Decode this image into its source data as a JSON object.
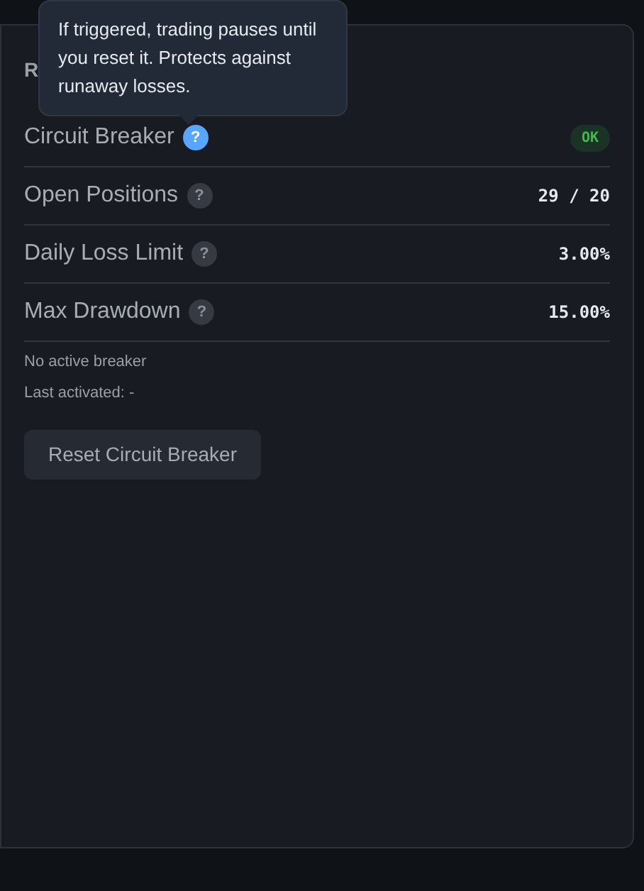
{
  "panel": {
    "title": "R"
  },
  "tooltip": {
    "text": "If triggered, trading pauses until you reset it. Protects against runaway losses."
  },
  "rows": [
    {
      "label": "Circuit Breaker",
      "help": "?",
      "help_active": true,
      "kind": "badge",
      "value": "OK"
    },
    {
      "label": "Open Positions",
      "help": "?",
      "help_active": false,
      "kind": "mono",
      "value": "29 / 20"
    },
    {
      "label": "Daily Loss Limit",
      "help": "?",
      "help_active": false,
      "kind": "mono",
      "value": "3.00%"
    },
    {
      "label": "Max Drawdown",
      "help": "?",
      "help_active": false,
      "kind": "mono",
      "value": "15.00%"
    }
  ],
  "notes": [
    "No active breaker",
    "Last activated: -"
  ],
  "button": "Reset Circuit Breaker"
}
